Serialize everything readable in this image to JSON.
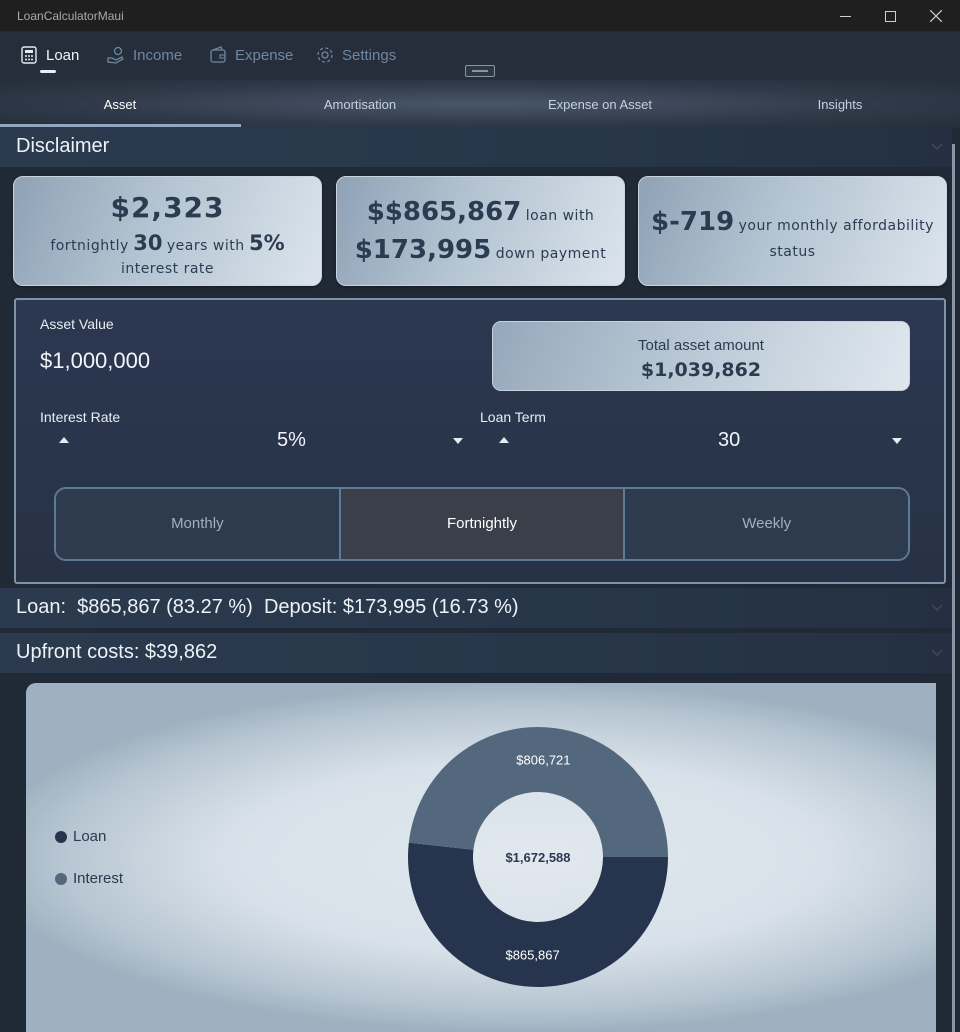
{
  "window": {
    "title": "LoanCalculatorMaui"
  },
  "nav": {
    "items": [
      {
        "label": "Loan",
        "icon": "calculator-icon",
        "active": true
      },
      {
        "label": "Income",
        "icon": "hand-coin-icon",
        "active": false
      },
      {
        "label": "Expense",
        "icon": "wallet-icon",
        "active": false
      },
      {
        "label": "Settings",
        "icon": "gear-icon",
        "active": false
      }
    ]
  },
  "subtabs": [
    "Asset",
    "Amortisation",
    "Expense on Asset",
    "Insights"
  ],
  "disclaimer": {
    "title": "Disclaimer"
  },
  "cards": {
    "payment": {
      "amount": "$2,323",
      "freq": "fortnightly",
      "years": "30",
      "years_text": "years with",
      "rate": "5%",
      "rate_text": "interest rate"
    },
    "loan": {
      "prefix": "$",
      "amount": "$865,867",
      "loan_text": "loan with",
      "down": "$173,995",
      "down_text": "down payment"
    },
    "afford": {
      "amount": "$-719",
      "text1": "your monthly affordability",
      "text2": "status"
    }
  },
  "form": {
    "asset_value_label": "Asset Value",
    "asset_value": "$1,000,000",
    "total_label": "Total asset amount",
    "total_value": "$1,039,862",
    "interest_label": "Interest Rate",
    "interest_value": "5%",
    "term_label": "Loan Term",
    "term_value": "30",
    "frequency": [
      "Monthly",
      "Fortnightly",
      "Weekly"
    ],
    "frequency_selected": "Fortnightly"
  },
  "loan_summary": "Loan:  $865,867 (83.27 %)  Deposit: $173,995 (16.73 %)",
  "upfront_summary": "Upfront costs: $39,862",
  "colors": {
    "loan": "#26354d",
    "interest": "#53687d",
    "accent": "#8fa7bf"
  },
  "chart_data": {
    "type": "pie",
    "donut": true,
    "center_label": "$1,672,588",
    "series": [
      {
        "name": "Loan",
        "value": 865867,
        "label": "$865,867",
        "color": "#26354d"
      },
      {
        "name": "Interest",
        "value": 806721,
        "label": "$806,721",
        "color": "#53687d"
      }
    ]
  }
}
